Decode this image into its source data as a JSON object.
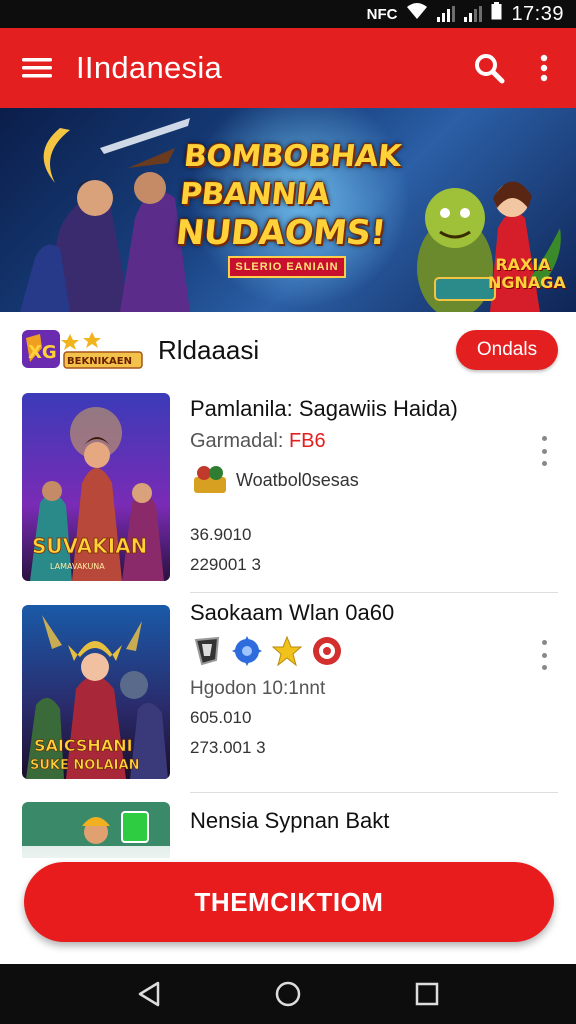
{
  "status_bar": {
    "nfc": "NFC",
    "time": "17:39"
  },
  "app_bar": {
    "title": "IIndanesia",
    "menu_icon": "hamburger-menu-icon",
    "search_icon": "search-icon",
    "more_icon": "more-vert-icon"
  },
  "banner": {
    "title_line1": "BOMBOBHAK",
    "title_line2": "PBANNIA",
    "title_line3": "NUDAOMS!",
    "ribbon": "SLERIO EANIAIN",
    "badge": "RAXIA NGNAGA"
  },
  "section": {
    "logo_text": "BEKNIKAEN",
    "title": "Rldaaasi",
    "button_label": "Ondals"
  },
  "games": [
    {
      "title": "Pamlanila: Sagawiis Haida)",
      "sub_prefix": "Garmadal: ",
      "sub_accent": "FB6",
      "tag": "Woatbol0sesas",
      "stat1": "36.9010",
      "stat2": "229001 3",
      "thumb_text": "SUVAKIAN",
      "thumb_sub": "LAMAVAKUNA"
    },
    {
      "title": "Saokaam Wlan 0a60",
      "sub": "Hgodon 10:1nnt",
      "stat1": "605.010",
      "stat2": "273.001 3",
      "thumb_text": "SAICSHANI",
      "thumb_sub": "SUKE NOLAIAN"
    },
    {
      "title": "Nensia Sypnan Bakt"
    }
  ],
  "cta": {
    "label": "THEMCIKTIOM"
  },
  "colors": {
    "brand_red": "#e41f1f",
    "status_bar": "#0d0d0d"
  }
}
